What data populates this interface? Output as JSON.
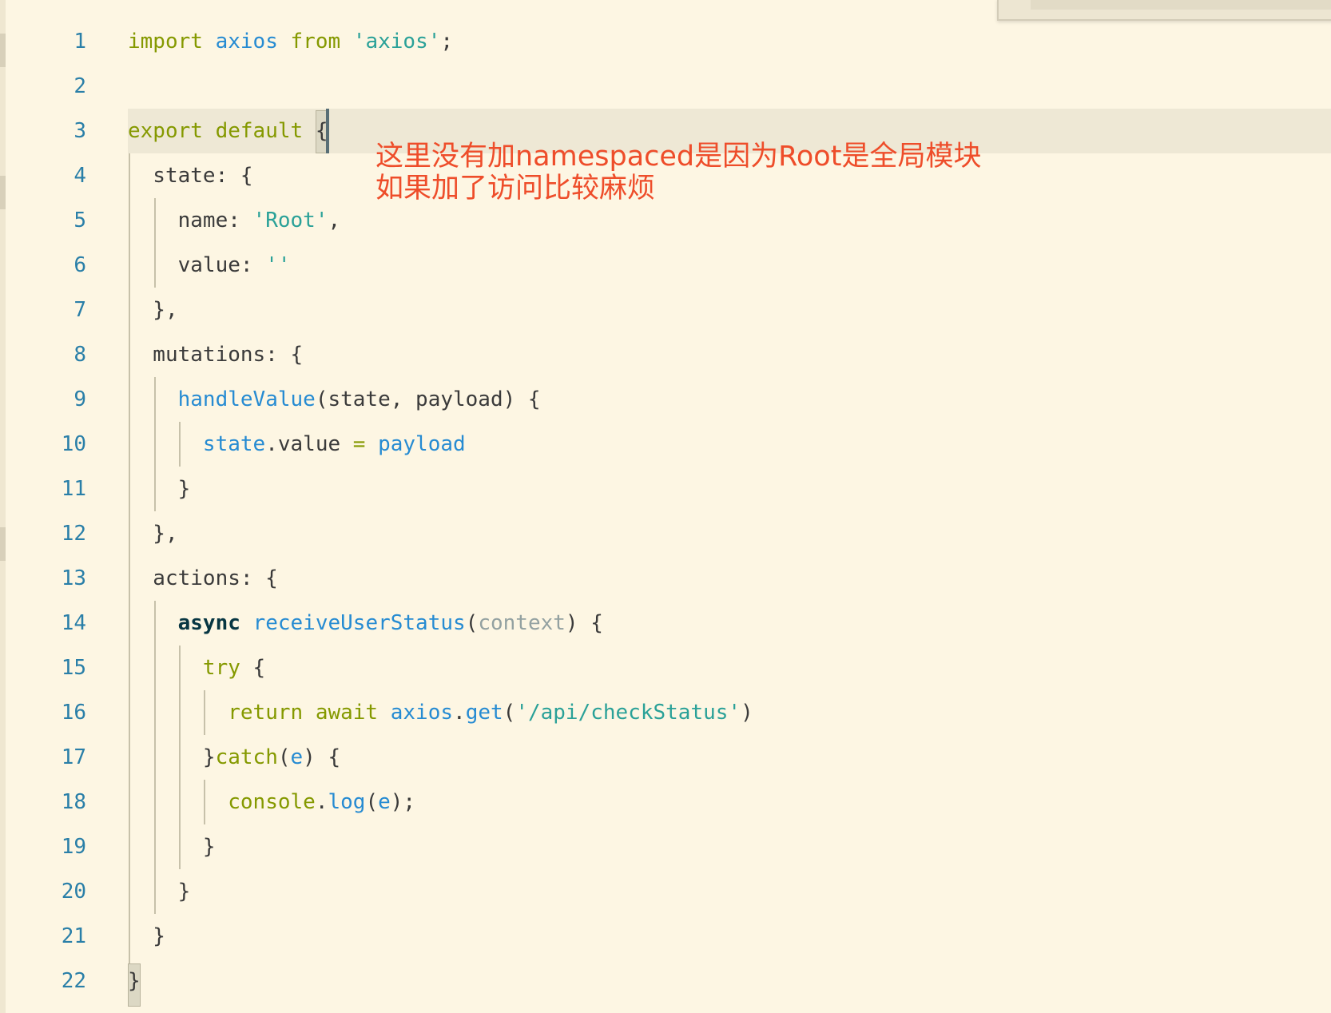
{
  "editor": {
    "annotation": {
      "line1": "这里没有加namespaced是因为Root是全局模块",
      "line2": "如果加了访问比较麻烦"
    },
    "lines": [
      {
        "n": "1",
        "tokens": [
          {
            "t": "import",
            "c": "kw-olive"
          },
          {
            "t": " "
          },
          {
            "t": "axios",
            "c": "kw-blue"
          },
          {
            "t": " "
          },
          {
            "t": "from",
            "c": "kw-olive"
          },
          {
            "t": " "
          },
          {
            "t": "'axios'",
            "c": "str"
          },
          {
            "t": ";"
          }
        ]
      },
      {
        "n": "2",
        "tokens": []
      },
      {
        "n": "3",
        "tokens": [
          {
            "t": "export",
            "c": "kw-olive"
          },
          {
            "t": " "
          },
          {
            "t": "default",
            "c": "kw-olive"
          },
          {
            "t": " "
          },
          {
            "t": "{"
          }
        ]
      },
      {
        "n": "4",
        "tokens": [
          {
            "t": "  state: {"
          }
        ]
      },
      {
        "n": "5",
        "tokens": [
          {
            "t": "    name: "
          },
          {
            "t": "'Root'",
            "c": "str"
          },
          {
            "t": ","
          }
        ]
      },
      {
        "n": "6",
        "tokens": [
          {
            "t": "    value: "
          },
          {
            "t": "''",
            "c": "str"
          }
        ]
      },
      {
        "n": "7",
        "tokens": [
          {
            "t": "  },"
          }
        ]
      },
      {
        "n": "8",
        "tokens": [
          {
            "t": "  mutations: {"
          }
        ]
      },
      {
        "n": "9",
        "tokens": [
          {
            "t": "    "
          },
          {
            "t": "handleValue",
            "c": "kw-blue"
          },
          {
            "t": "(state, payload) {"
          }
        ]
      },
      {
        "n": "10",
        "tokens": [
          {
            "t": "      "
          },
          {
            "t": "state",
            "c": "kw-blue"
          },
          {
            "t": ".value "
          },
          {
            "t": "=",
            "c": "kw-olive"
          },
          {
            "t": " "
          },
          {
            "t": "payload",
            "c": "kw-blue"
          }
        ]
      },
      {
        "n": "11",
        "tokens": [
          {
            "t": "    }"
          }
        ]
      },
      {
        "n": "12",
        "tokens": [
          {
            "t": "  },"
          }
        ]
      },
      {
        "n": "13",
        "tokens": [
          {
            "t": "  actions: {"
          }
        ]
      },
      {
        "n": "14",
        "tokens": [
          {
            "t": "    "
          },
          {
            "t": "async",
            "c": "dark-bold"
          },
          {
            "t": " "
          },
          {
            "t": "receiveUserStatus",
            "c": "kw-blue"
          },
          {
            "t": "("
          },
          {
            "t": "context",
            "c": "param"
          },
          {
            "t": ") {"
          }
        ]
      },
      {
        "n": "15",
        "tokens": [
          {
            "t": "      "
          },
          {
            "t": "try",
            "c": "kw-olive"
          },
          {
            "t": " {"
          }
        ]
      },
      {
        "n": "16",
        "tokens": [
          {
            "t": "        "
          },
          {
            "t": "return",
            "c": "kw-olive"
          },
          {
            "t": " "
          },
          {
            "t": "await",
            "c": "kw-olive"
          },
          {
            "t": " "
          },
          {
            "t": "axios",
            "c": "kw-blue"
          },
          {
            "t": "."
          },
          {
            "t": "get",
            "c": "kw-blue"
          },
          {
            "t": "("
          },
          {
            "t": "'/api/checkStatus'",
            "c": "str"
          },
          {
            "t": ")"
          }
        ]
      },
      {
        "n": "17",
        "tokens": [
          {
            "t": "      }"
          },
          {
            "t": "catch",
            "c": "kw-olive"
          },
          {
            "t": "("
          },
          {
            "t": "e",
            "c": "kw-blue"
          },
          {
            "t": ") {"
          }
        ]
      },
      {
        "n": "18",
        "tokens": [
          {
            "t": "        "
          },
          {
            "t": "console",
            "c": "kw-olive"
          },
          {
            "t": "."
          },
          {
            "t": "log",
            "c": "kw-blue"
          },
          {
            "t": "("
          },
          {
            "t": "e",
            "c": "kw-blue"
          },
          {
            "t": ");"
          }
        ]
      },
      {
        "n": "19",
        "tokens": [
          {
            "t": "      }"
          }
        ]
      },
      {
        "n": "20",
        "tokens": [
          {
            "t": "    }"
          }
        ]
      },
      {
        "n": "21",
        "tokens": [
          {
            "t": "  }"
          }
        ]
      },
      {
        "n": "22",
        "tokens": [
          {
            "t": "}"
          }
        ]
      }
    ]
  }
}
